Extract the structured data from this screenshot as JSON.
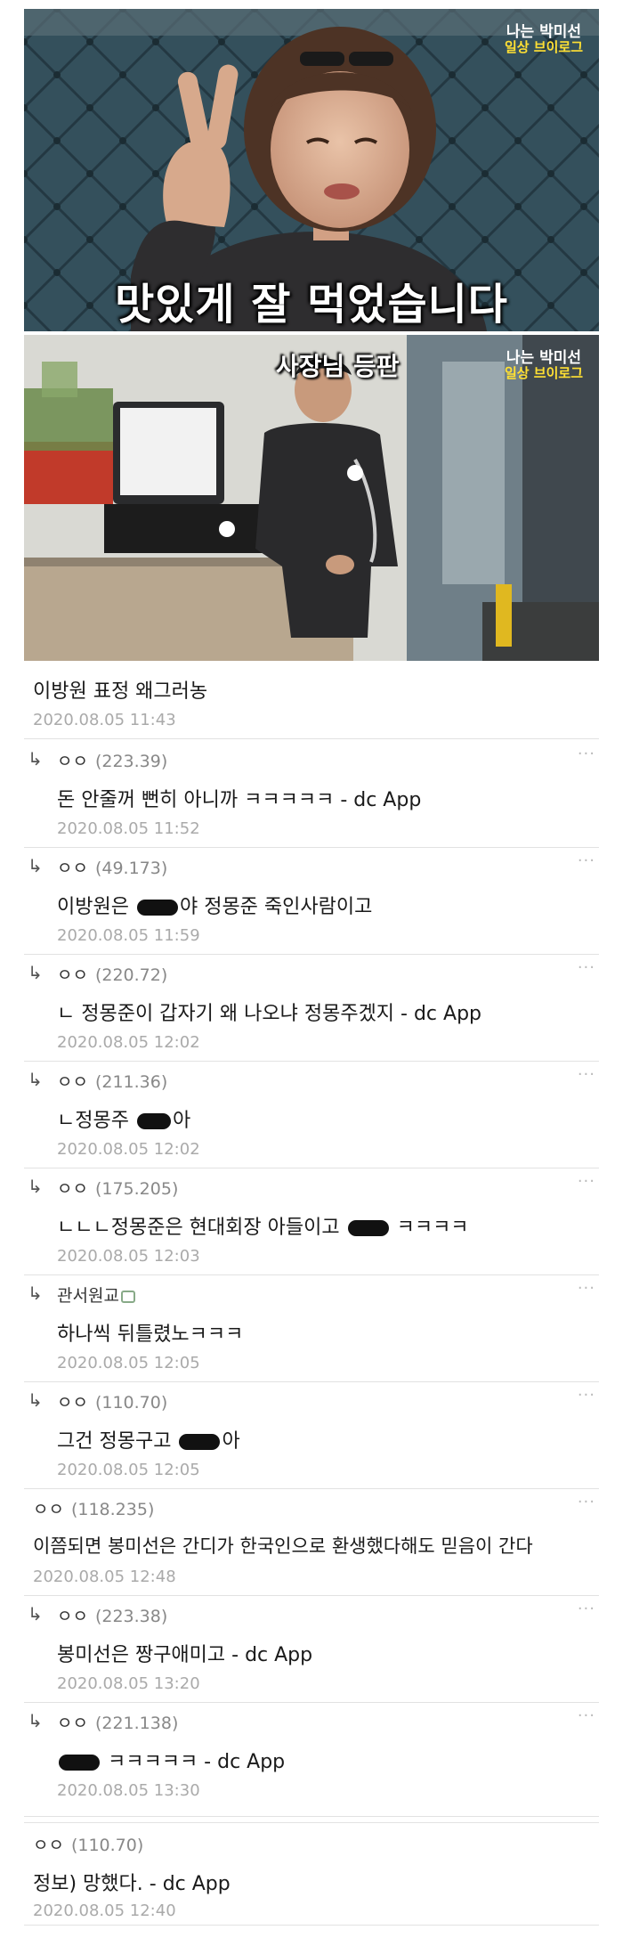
{
  "video": {
    "channel_tag_line1": "나는 박미선",
    "channel_tag_line2": "일상 브이로그",
    "frame1_caption": "맛있게 잘 먹었습니다",
    "frame2_caption": "사장님 등판"
  },
  "comments": [
    {
      "type": "top",
      "nick": "",
      "ip": "",
      "body": "이방원 표정 왜그러농",
      "date": "2020.08.05 11:43"
    },
    {
      "type": "reply",
      "nick": "ㅇㅇ",
      "ip": "(223.39)",
      "body": "돈 안줄꺼 뻔히 아니까 ㅋㅋㅋㅋㅋ - dc App",
      "date": "2020.08.05 11:52"
    },
    {
      "type": "reply",
      "nick": "ㅇㅇ",
      "ip": "(49.173)",
      "body_pre": "이방원은 ",
      "body_post": "야 정몽준 죽인사람이고",
      "date": "2020.08.05 11:59"
    },
    {
      "type": "reply",
      "nick": "ㅇㅇ",
      "ip": "(220.72)",
      "body": "ㄴ 정몽준이 갑자기 왜 나오냐 정몽주겠지 - dc App",
      "date": "2020.08.05 12:02"
    },
    {
      "type": "reply",
      "nick": "ㅇㅇ",
      "ip": "(211.36)",
      "body_pre": "ㄴ정몽주 ",
      "body_post": "아",
      "date": "2020.08.05 12:02"
    },
    {
      "type": "reply",
      "nick": "ㅇㅇ",
      "ip": "(175.205)",
      "body_pre": "ㄴㄴㄴ정몽준은 현대회장 아들이고 ",
      "body_post": " ㅋㅋㅋㅋ",
      "date": "2020.08.05 12:03"
    },
    {
      "type": "reply",
      "nick": "관서원교",
      "ip": "",
      "body": "하나씩 뒤틀렸노ㅋㅋㅋ",
      "date": "2020.08.05 12:05"
    },
    {
      "type": "reply",
      "nick": "ㅇㅇ",
      "ip": "(110.70)",
      "body_pre": "그건 정몽구고 ",
      "body_post": "아",
      "date": "2020.08.05 12:05"
    },
    {
      "type": "top",
      "nick": "ㅇㅇ",
      "ip": "(118.235)",
      "body": "이쯤되면 봉미선은 간디가 한국인으로 환생했다해도 믿음이 간다",
      "date": "2020.08.05 12:48"
    },
    {
      "type": "reply",
      "nick": "ㅇㅇ",
      "ip": "(223.38)",
      "body": "봉미선은 짱구애미고 - dc App",
      "date": "2020.08.05 13:20"
    },
    {
      "type": "reply",
      "nick": "ㅇㅇ",
      "ip": "(221.138)",
      "body_pre": "",
      "body_post": " ㅋㅋㅋㅋㅋ - dc App",
      "date": "2020.08.05 13:30"
    },
    {
      "type": "top",
      "nick": "ㅇㅇ",
      "ip": "(110.70)",
      "body": "정보) 망했다. - dc App",
      "date": "2020.08.05 12:40"
    }
  ],
  "icons": {
    "reply": "reply-arrow-icon",
    "more": "more-dots-icon",
    "cert": "certified-badge-icon"
  },
  "colors": {
    "tag_yellow": "#ffe033",
    "meta_gray": "#888888",
    "divider": "#e2e2e2"
  }
}
